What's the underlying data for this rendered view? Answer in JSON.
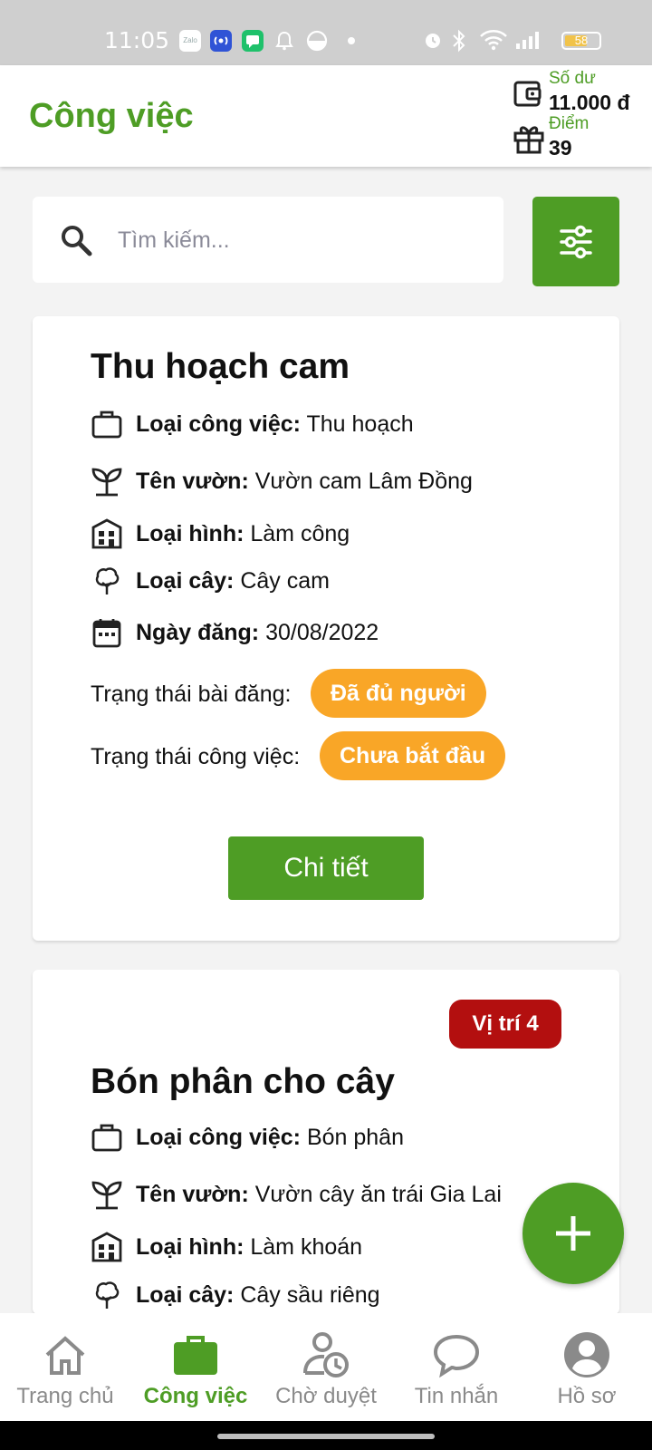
{
  "status_bar": {
    "time": "11:05",
    "zalo_label": "Zalo",
    "battery": "58"
  },
  "header": {
    "title": "Công việc",
    "balance_label": "Số dư",
    "balance_value": "11.000 đ",
    "points_label": "Điểm",
    "points_value": "39"
  },
  "search": {
    "placeholder": "Tìm kiếm..."
  },
  "jobs": [
    {
      "title": "Thu hoạch cam",
      "job_type_label": "Loại công việc:",
      "job_type": "Thu hoạch",
      "garden_label": "Tên vườn:",
      "garden": "Vườn cam Lâm Đồng",
      "work_type_label": "Loại hình:",
      "work_type": "Làm công",
      "tree_label": "Loại cây:",
      "tree": "Cây cam",
      "date_label": "Ngày đăng:",
      "date": "30/08/2022",
      "post_status_label": "Trạng thái bài đăng:",
      "post_status": "Đã đủ người",
      "work_status_label": "Trạng thái công việc:",
      "work_status": "Chưa bắt đầu",
      "detail_button": "Chi tiết"
    },
    {
      "position_badge": "Vị trí 4",
      "title": "Bón phân cho cây",
      "job_type_label": "Loại công việc:",
      "job_type": "Bón phân",
      "garden_label": "Tên vườn:",
      "garden": "Vườn cây ăn trái Gia Lai",
      "work_type_label": "Loại hình:",
      "work_type": "Làm khoán",
      "tree_label": "Loại cây:",
      "tree": "Cây sầu riêng"
    }
  ],
  "bottom_nav": [
    {
      "label": "Trang chủ",
      "icon": "home-icon",
      "active": false
    },
    {
      "label": "Công việc",
      "icon": "briefcase-icon",
      "active": true
    },
    {
      "label": "Chờ duyệt",
      "icon": "user-clock-icon",
      "active": false
    },
    {
      "label": "Tin nhắn",
      "icon": "chat-bubble-icon",
      "active": false
    },
    {
      "label": "Hồ sơ",
      "icon": "account-circle-icon",
      "active": false
    }
  ],
  "colors": {
    "brand_green": "#4e9d25",
    "status_orange": "#f9a627",
    "badge_red": "#b30f0f"
  }
}
